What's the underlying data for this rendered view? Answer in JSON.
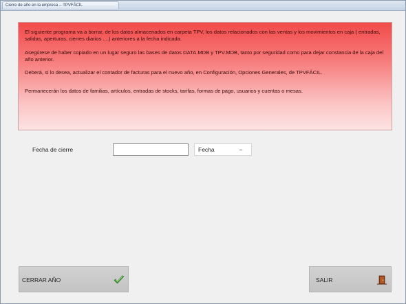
{
  "window": {
    "title": "Cierre de año en la empresa -- TPVFÁCIL"
  },
  "info": {
    "paragraph1": "El siguiente programa va a borrar, de los datos almacenados en carpeta TPV, los datos relacionados con las ventas y los movimientos en caja ( entradas, salidas, aperturas, cierres diarios ....) anteriores a la fecha indicada.",
    "paragraph2": "Asegúrese de haber copiado en un lugar seguro las bases de datos DATA.MDB y TPV.MDB, tanto  por seguridad como para dejar constancia de la caja del año anterior.",
    "paragraph3": "Deberá, si lo desea, actualizar el contador de facturas para el nuevo año, en Configuración, Opciones Generales, de TPVFÁCIL.",
    "paragraph4": "Permanecerán los datos de familias, artículos, entradas de stocks, tarifas, formas de pago, usuarios y cuentas o mesas."
  },
  "form": {
    "date_label": "Fecha de cierre",
    "date_value": "",
    "date_placeholder": "",
    "picker_label": "Fecha",
    "picker_button": "–"
  },
  "buttons": {
    "close_year_label": "CERRAR AÑO",
    "close_year_icon": "checkmark-icon",
    "exit_label": "SALIR",
    "exit_icon": "door-exit-icon"
  },
  "colors": {
    "panel_top": "#f24a4a",
    "panel_bottom": "#fde3e3",
    "check_green": "#3c9b2e",
    "exit_brown": "#8a3b16"
  }
}
